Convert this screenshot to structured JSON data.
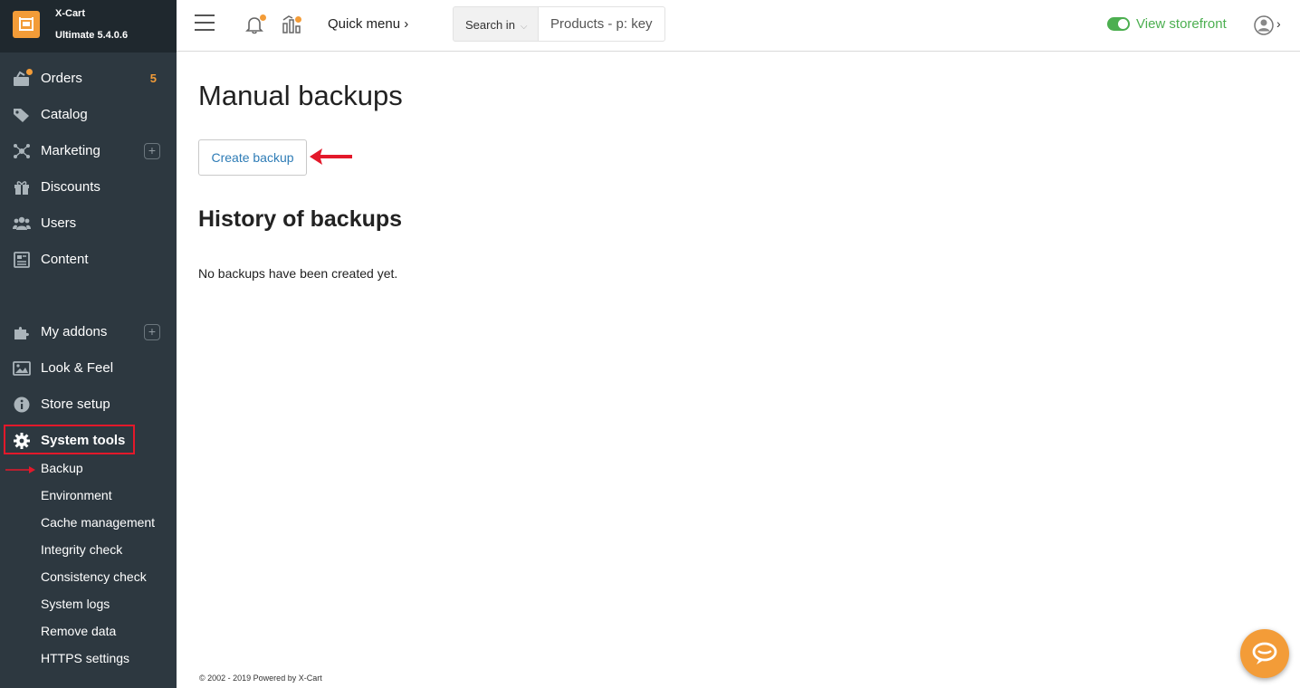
{
  "brand": {
    "name": "X-Cart",
    "version": "Ultimate 5.4.0.6"
  },
  "sidebar": {
    "items": [
      {
        "label": "Orders",
        "badge": "5",
        "icon": "orders-icon"
      },
      {
        "label": "Catalog",
        "icon": "tag-icon"
      },
      {
        "label": "Marketing",
        "icon": "network-icon"
      },
      {
        "label": "Discounts",
        "icon": "gift-icon"
      },
      {
        "label": "Users",
        "icon": "users-icon"
      },
      {
        "label": "Content",
        "icon": "newspaper-icon"
      },
      {
        "label": "My addons",
        "icon": "puzzle-icon"
      },
      {
        "label": "Look & Feel",
        "icon": "image-icon"
      },
      {
        "label": "Store setup",
        "icon": "info-icon"
      },
      {
        "label": "System tools",
        "icon": "gear-icon"
      }
    ],
    "subitems": [
      "Backup",
      "Environment",
      "Cache management",
      "Integrity check",
      "Consistency check",
      "System logs",
      "Remove data",
      "HTTPS settings"
    ]
  },
  "topbar": {
    "quick_menu": "Quick menu",
    "search_in": "Search in",
    "search_placeholder": "Products - p: key",
    "storefront": "View storefront"
  },
  "main": {
    "title": "Manual backups",
    "create_button": "Create backup",
    "history_title": "History of backups",
    "empty_text": "No backups have been created yet."
  },
  "footer": {
    "text": "© 2002 - 2019 Powered by X-Cart"
  },
  "colors": {
    "sidebar": "#2d3840",
    "accent": "#f39c38",
    "link": "#2e7cb6",
    "success": "#4caf50",
    "annotation": "#e3182a"
  }
}
